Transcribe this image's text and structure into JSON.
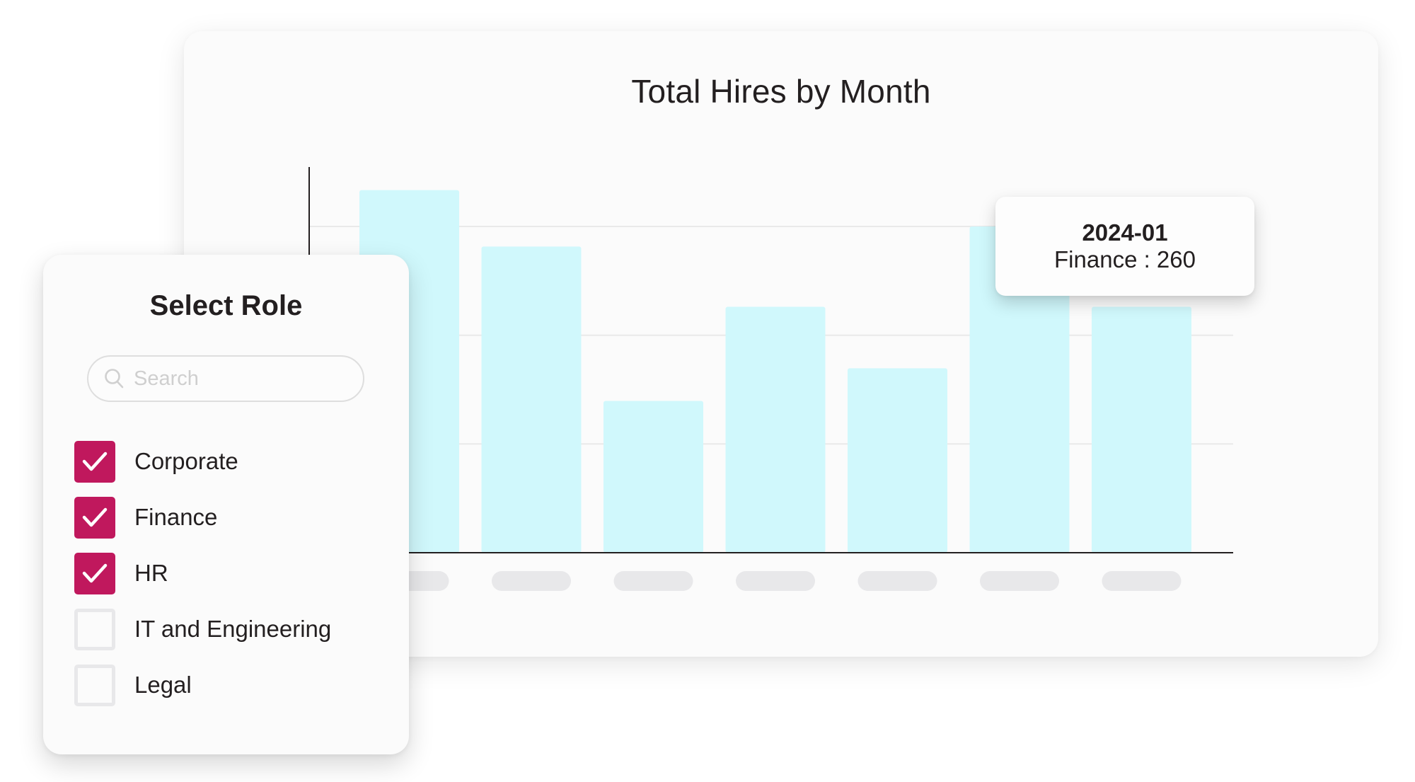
{
  "chart_data": {
    "type": "bar",
    "title": "Total Hires by Month",
    "xlabel": "",
    "ylabel": "",
    "categories": [
      "",
      "",
      "",
      "",
      "",
      "2024-01",
      ""
    ],
    "series": [
      {
        "name": "Total Hires",
        "values": [
          289,
          244,
          121,
          196,
          147,
          260,
          196
        ]
      }
    ],
    "ylim": [
      0,
      320
    ],
    "gridlines": [
      86.7,
      173.3,
      260
    ],
    "grid": true,
    "x_tick_labels_redacted": true,
    "bar_color": "#d0f8fc",
    "axis_color": "#231f20",
    "gridline_color": "#e9e9e9",
    "placeholder_label_color": "#e8e8ea"
  },
  "tooltip": {
    "title": "2024-01",
    "body": "Finance : 260",
    "series": "Finance",
    "value": 260,
    "hovered_index": 5
  },
  "filter": {
    "title": "Select Role",
    "search": {
      "placeholder": "Search",
      "value": "",
      "icon": "search-icon"
    },
    "accent_color": "#c0185d",
    "options": [
      {
        "label": "Corporate",
        "checked": true
      },
      {
        "label": "Finance",
        "checked": true
      },
      {
        "label": "HR",
        "checked": true
      },
      {
        "label": "IT and Engineering",
        "checked": false
      },
      {
        "label": "Legal",
        "checked": false
      }
    ]
  }
}
